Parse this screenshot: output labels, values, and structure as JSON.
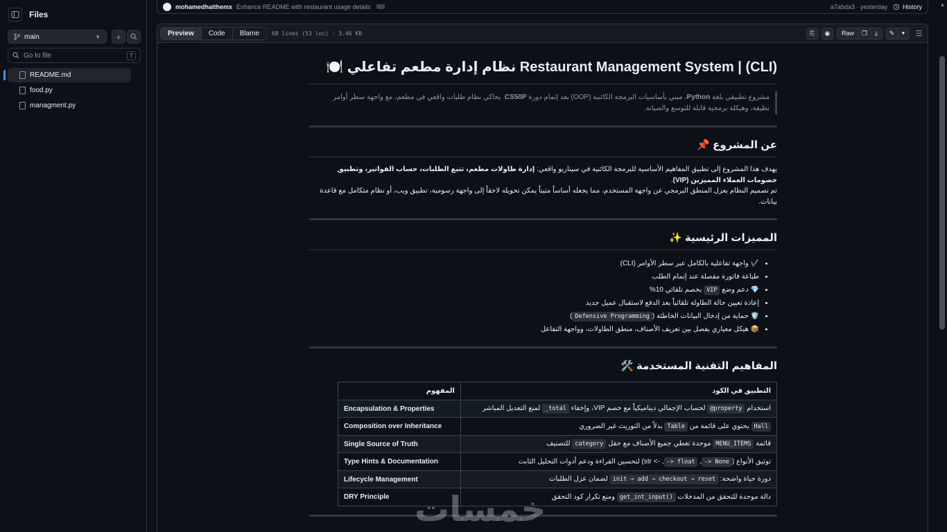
{
  "sidebar": {
    "title": "Files",
    "branch": "main",
    "goto_placeholder": "Go to file",
    "goto_shortcut": "T",
    "files": [
      {
        "name": "README.md",
        "active": true
      },
      {
        "name": "food.py",
        "active": false
      },
      {
        "name": "managment.py",
        "active": false
      }
    ]
  },
  "commit": {
    "author": "mohamedhaithemx",
    "message": "Enhance README with restaurant usage details",
    "hash_time": "a7abda3 · yesterday",
    "history_label": "History"
  },
  "viewer": {
    "tabs": [
      "Preview",
      "Code",
      "Blame"
    ],
    "active_tab": "Preview",
    "meta": "68 lines (53 loc) · 3.46 KB",
    "raw_label": "Raw"
  },
  "readme": {
    "title": "Restaurant Management System | (CLI) نظام إدارة مطعم تفاعلي 🍽️",
    "intro": {
      "part1": "مشروع تطبيقي بلغة ",
      "lang": "Python",
      "part2": "، مبني بأساسيات البرمجة الكائنية (OOP) بعد إتمام دورة ",
      "course": "CS50P",
      "part3": ". يحاكي نظام طلبات واقعي في مطعم، مع واجهة سطر أوامر نظيفة، وهيكلة برمجية قابلة للتوسع والصيانة."
    },
    "about": {
      "heading": "عن المشروع 📌",
      "p1_pre": "يهدف هذا المشروع إلى تطبيق المفاهيم الأساسية للبرمجة الكائنية في سيناريو واقعي: ",
      "p1_bold": "إدارة طاولات مطعم، تتبع الطلبات، حساب الفواتير، وتطبيق خصومات العملاء المميزين (VIP)",
      "p1_post": ".",
      "p2": "تم تصميم النظام بعزل المنطق البرمجي عن واجهة المستخدم، مما يجعله أساساً متيناً يمكن تحويله لاحقاً إلى واجهة رسومية، تطبيق ويب، أو نظام متكامل مع قاعدة بيانات."
    },
    "features": {
      "heading": "المميزات الرئيسية ✨",
      "items": [
        {
          "pre": "✔️ واجهة تفاعلية بالكامل عبر سطر الأوامر (CLI)",
          "code": "",
          "post": ""
        },
        {
          "pre": "طباعة فاتورة مفصلة عند إتمام الطلب",
          "code": "",
          "post": ""
        },
        {
          "pre": "💎 دعم وضع ",
          "code": "VIP",
          "post": " بخصم تلقائي 10%"
        },
        {
          "pre": "إعادة تعيين حالة الطاولة تلقائياً بعد الدفع لاستقبال عميل جديد",
          "code": "",
          "post": ""
        },
        {
          "pre": "🛡️ حماية من إدخال البيانات الخاطئة (",
          "code": "Defensive Programming",
          "post": ")"
        },
        {
          "pre": "📦 هيكل معياري يفصل بين تعريف الأصناف، منطق الطاولات، وواجهة التفاعل",
          "code": "",
          "post": ""
        }
      ]
    },
    "concepts": {
      "heading": "المفاهيم التقنية المستخدمة 🛠️",
      "headers": [
        "المفهوم",
        "التطبيق في الكود"
      ],
      "rows": [
        {
          "concept": "Encapsulation & Properties",
          "a": "استخدام ",
          "c1": "@property",
          "b": " لحساب الإجمالي ديناميكياً مع خصم VIP، وإخفاء ",
          "c2": "_total",
          "d": " لمنع التعديل المباشر"
        },
        {
          "concept": "Composition over Inheritance",
          "a": "",
          "c1": "Hall",
          "b": " يحتوي على قائمة من ",
          "c2": "Table",
          "d": " بدلاً من التوريث غير الضروري"
        },
        {
          "concept": "Single Source of Truth",
          "a": "قائمة ",
          "c1": "MENU_ITEMS",
          "b": " موحدة تغطي جميع الأصناف مع حقل ",
          "c2": "category",
          "d": " للتصنيف"
        },
        {
          "concept": "Type Hints & Documentation",
          "a": "توثيق الأنواع (",
          "c1": "-> None",
          "b": ", ",
          "c2": "-> float",
          "d": ", -> str) لتحسين القراءة ودعم أدوات التحليل الثابت"
        },
        {
          "concept": "Lifecycle Management",
          "a": "دورة حياة واضحة: ",
          "c1": "init → add → checkout → reset",
          "b": " لضمان عزل الطلبات",
          "c2": "",
          "d": ""
        },
        {
          "concept": "DRY Principle",
          "a": "دالة موحدة للتحقق من المدخلات ",
          "c1": "get_int_input()",
          "b": " ومنع تكرار كود التحقق",
          "c2": "",
          "d": ""
        }
      ]
    }
  },
  "watermark": "خمسات",
  "colors": {
    "background": "#0d1117",
    "border": "#30363d",
    "text": "#e6edf3",
    "muted": "#9198a1",
    "accent": "#4493f8"
  }
}
